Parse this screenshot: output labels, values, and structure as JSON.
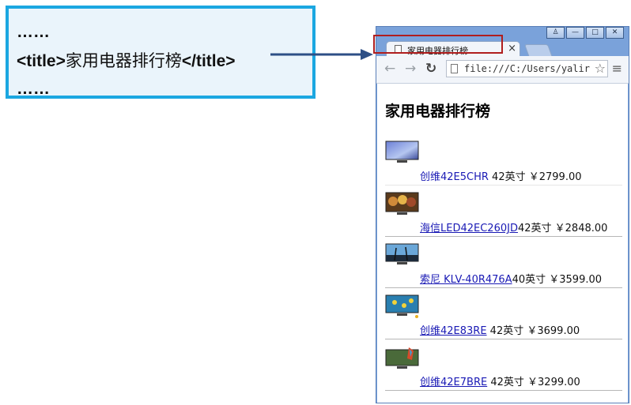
{
  "code": {
    "line1": "……",
    "line2_open": "<title>",
    "line2_text": "家用电器排行榜",
    "line2_close": "</title>",
    "line3": "……"
  },
  "browser": {
    "tab_title": "家用电器排行榜",
    "tab_close": "×",
    "url": "file:///C:/Users/yalir",
    "page_heading": "家用电器排行榜"
  },
  "products": [
    {
      "name": "创维42E5CHR",
      "spec": " 42英寸",
      "price": " ￥2799.00"
    },
    {
      "name": "海信LED42EC260JD",
      "spec": "42英寸",
      "price": " ￥2848.00"
    },
    {
      "name": "索尼 KLV-40R476A",
      "spec": "40英寸",
      "price": " ￥3599.00"
    },
    {
      "name": "创维42E83RE",
      "spec": " 42英寸",
      "price": " ￥3699.00"
    },
    {
      "name": "创维42E7BRE",
      "spec": " 42英寸",
      "price": " ￥3299.00"
    }
  ]
}
